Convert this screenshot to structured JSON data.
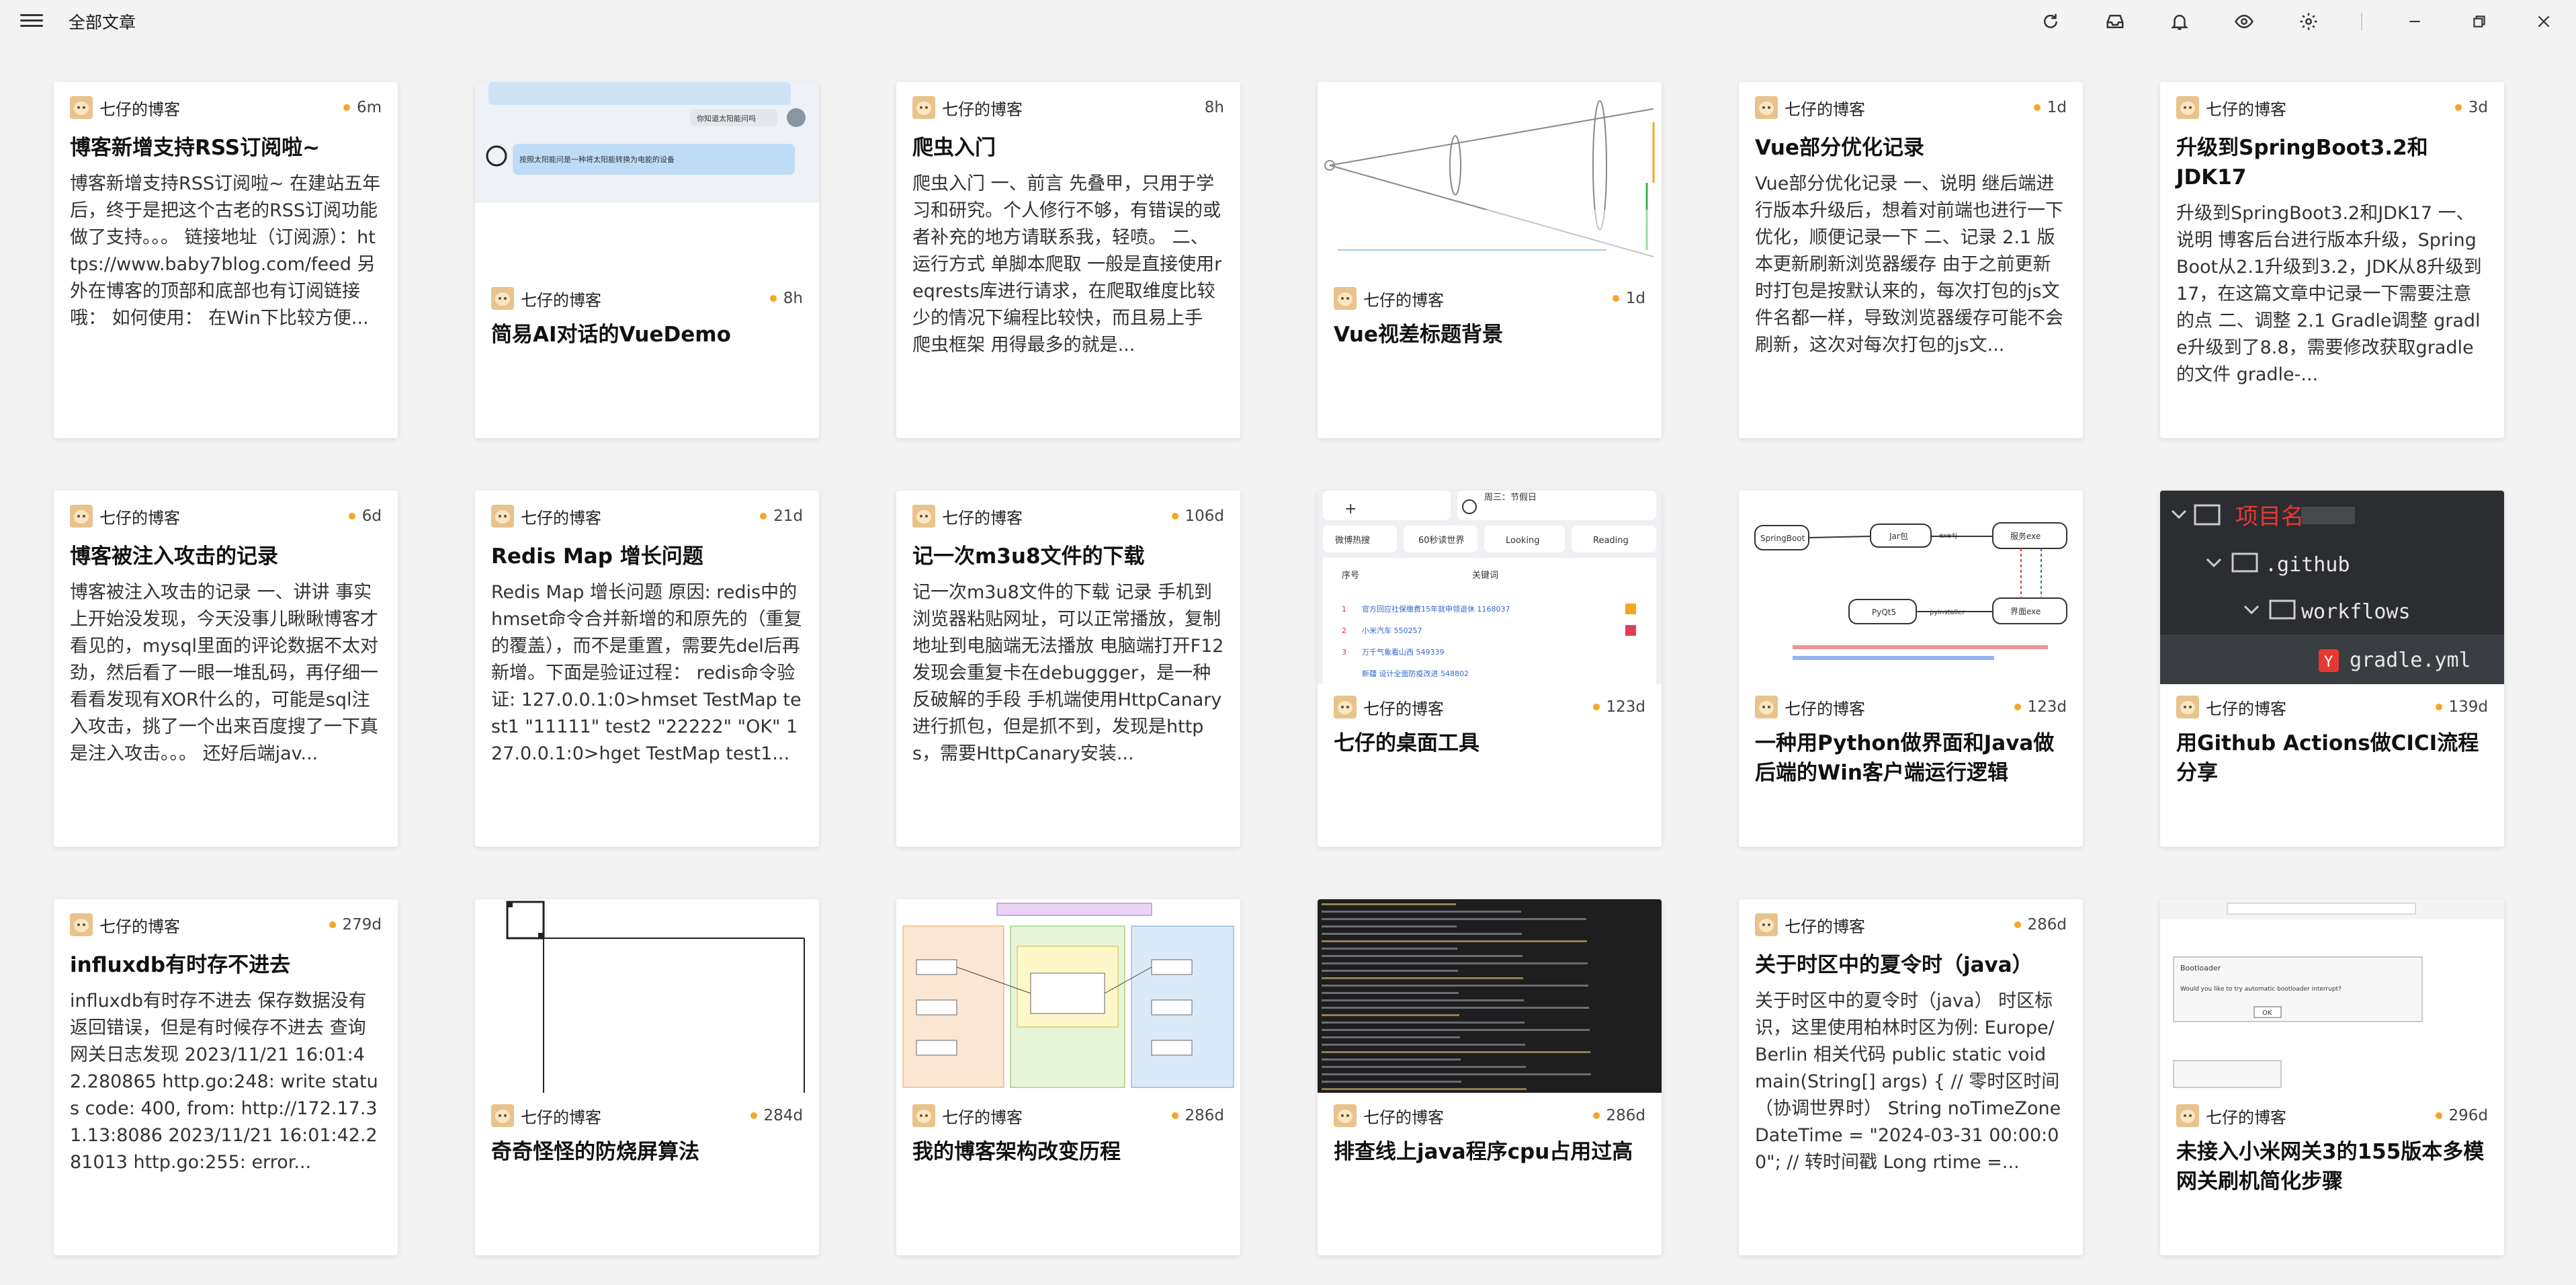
{
  "app": {
    "title": "全部文章"
  },
  "toolbar": {
    "icons": [
      "refresh-icon",
      "inbox-icon",
      "bell-icon",
      "eye-icon",
      "gear-icon"
    ]
  },
  "window": {
    "controls": [
      "minimize",
      "restore",
      "close"
    ]
  },
  "colors": {
    "dot": "#f5a623",
    "background": "#f3f3f3",
    "card": "#ffffff"
  },
  "cards": [
    {
      "author": "七仔的博客",
      "time": "6m",
      "title": "博客新增支持RSS订阅啦~",
      "excerpt": "博客新增支持RSS订阅啦~ 在建站五年后，终于是把这个古老的RSS订阅功能做了支持。。。 链接地址（订阅源）：https://www.baby7blog.com/feed 另外在博客的顶部和底部也有订阅链接哦： 如何使用： 在Win下比较方便..."
    },
    {
      "author": "七仔的博客",
      "time": "8h",
      "title": "简易AI对话的VueDemo",
      "thumb_text": [
        "你知道太阳能问吗",
        "按照太阳能问是一种将太阳能转换为电能的设备"
      ]
    },
    {
      "author": "七仔的博客",
      "time": "8h",
      "title": "爬虫入门",
      "excerpt": "爬虫入门 一、前言 先叠甲，只用于学习和研究。个人修行不够，有错误的或者补充的地方请联系我，轻喷。 二、运行方式 单脚本爬取 一般是直接使用reqrests库进行请求，在爬取维度比较少的情况下编程比较快，而且易上手 爬虫框架 用得最多的就是..."
    },
    {
      "author": "七仔的博客",
      "time": "1d",
      "title": "Vue视差标题背景"
    },
    {
      "author": "七仔的博客",
      "time": "1d",
      "title": "Vue部分优化记录",
      "excerpt": "Vue部分优化记录 一、说明 继后端进行版本升级后，想着对前端也进行一下优化，顺便记录一下 二、记录 2.1 版本更新刷新浏览器缓存 由于之前更新时打包是按默认来的，每次打包的js文件名都一样，导致浏览器缓存可能不会刷新，这次对每次打包的js文..."
    },
    {
      "author": "七仔的博客",
      "time": "3d",
      "title": "升级到SpringBoot3.2和JDK17",
      "excerpt": "升级到SpringBoot3.2和JDK17 一、说明 博客后台进行版本升级，SpringBoot从2.1升级到3.2，JDK从8升级到17，在这篇文章中记录一下需要注意的点 二、调整 2.1 Gradle调整 gradle升级到了8.8，需要修改获取gradle的文件 gradle-..."
    },
    {
      "author": "七仔的博客",
      "time": "6d",
      "title": "博客被注入攻击的记录",
      "excerpt": "博客被注入攻击的记录 一、讲讲 事实上开始没发现，今天没事儿瞅瞅博客才看见的，mysql里面的评论数据不太对劲，然后看了一眼一堆乱码，再仔细一看看发现有XOR什么的，可能是sql注入攻击，挑了一个出来百度搜了一下真是注入攻击。。。 还好后端jav..."
    },
    {
      "author": "七仔的博客",
      "time": "21d",
      "title": "Redis Map 增长问题",
      "excerpt": "Redis Map 增长问题 原因: redis中的hmset命令合并新增的和原先的（重复的覆盖），而不是重置，需要先del后再新增。下面是验证过程： redis命令验证: 127.0.0.1:0>hmset TestMap test1 \"11111\" test2 \"22222\" \"OK\" 127.0.0.1:0>hget TestMap test1..."
    },
    {
      "author": "七仔的博客",
      "time": "106d",
      "title": "记一次m3u8文件的下载",
      "excerpt": "记一次m3u8文件的下载 记录 手机到浏览器粘贴网址，可以正常播放，复制地址到电脑端无法播放 电脑端打开F12发现会重复卡在debuggger，是一种反破解的手段 手机端使用HttpCanary进行抓包，但是抓不到，发现是https，需要HttpCanary安装..."
    },
    {
      "author": "七仔的博客",
      "time": "123d",
      "title": "七仔的桌面工具",
      "thumb_text": [
        "周三：节假日",
        "微博热搜",
        "60秒读世界",
        "Looking",
        "Reading",
        "序号",
        "关键词",
        "官方回应社保缴费15年就申领退休 1168037",
        "小米汽车 550257",
        "万千气象看山西 549339",
        "新疆 设计全面防疫改进 548802"
      ]
    },
    {
      "author": "七仔的博客",
      "time": "123d",
      "title": "一种用Python做界面和Java做后端的Win客户端运行逻辑",
      "thumb_text": [
        "SpringBoot",
        "Jar包",
        "exe4j",
        "服务exe",
        "PyQt5",
        "pyinstaller",
        "界面exe"
      ]
    },
    {
      "author": "七仔的博客",
      "time": "139d",
      "title": "用Github Actions做CICI流程分享",
      "thumb_text": [
        "项目名",
        ".github",
        "workflows",
        "gradle.yml"
      ]
    },
    {
      "author": "七仔的博客",
      "time": "279d",
      "title": "influxdb有时存不进去",
      "excerpt": "influxdb有时存不进去 保存数据没有返回错误，但是有时候存不进去 查询网关日志发现 2023/11/21 16:01:42.280865 http.go:248: write status code: 400, from: http://172.17.31.13:8086 2023/11/21 16:01:42.281013 http.go:255: error..."
    },
    {
      "author": "七仔的博客",
      "time": "284d",
      "title": "奇奇怪怪的防烧屏算法"
    },
    {
      "author": "七仔的博客",
      "time": "286d",
      "title": "我的博客架构改变历程"
    },
    {
      "author": "七仔的博客",
      "time": "286d",
      "title": "排查线上java程序cpu占用过高"
    },
    {
      "author": "七仔的博客",
      "time": "286d",
      "title": "关于时区中的夏令时（java）",
      "excerpt": "关于时区中的夏令时（java） 时区标识，这里使用柏林时区为例: Europe/Berlin 相关代码 public static void main(String[] args) { // 零时区时间（协调世界时） String noTimeZoneDateTime = \"2024-03-31 00:00:00\"; // 转时间戳 Long rtime =..."
    },
    {
      "author": "七仔的博客",
      "time": "296d",
      "title": "未接入小米网关3的155版本多模网关刷机简化步骤",
      "thumb_text": [
        "Bootloader",
        "Would you like to try automatic bootloader interrupt?",
        "OK"
      ]
    }
  ]
}
